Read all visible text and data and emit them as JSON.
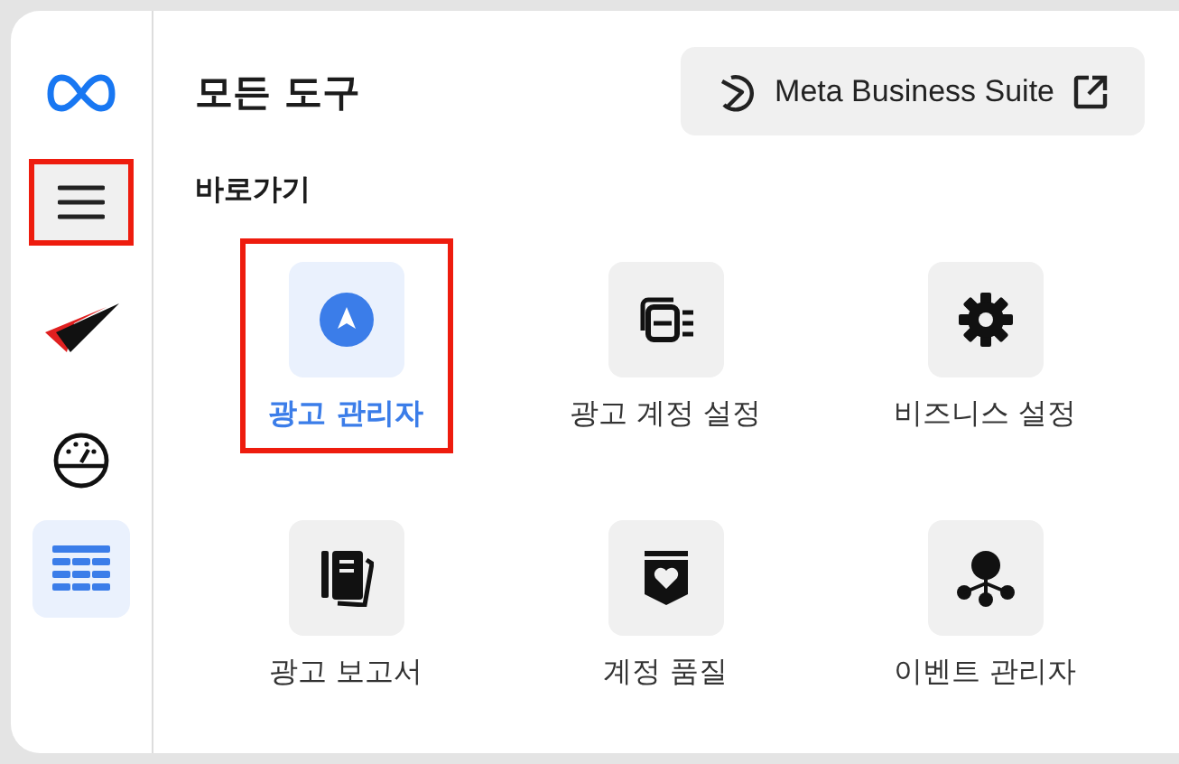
{
  "sidebar": {
    "items": [
      {
        "kind": "logo",
        "selected": false,
        "highlighted": false
      },
      {
        "kind": "menu",
        "selected": false,
        "highlighted": true
      },
      {
        "kind": "swoosh",
        "selected": false,
        "highlighted": false
      },
      {
        "kind": "gauge",
        "selected": false,
        "highlighted": false
      },
      {
        "kind": "table",
        "selected": true,
        "highlighted": false
      }
    ]
  },
  "header": {
    "title": "모든 도구",
    "button": "Meta Business Suite"
  },
  "section": {
    "title": "바로가기"
  },
  "tools": [
    {
      "kind": "compass",
      "label": "광고 관리자",
      "selected": true,
      "highlighted": true
    },
    {
      "kind": "cards",
      "label": "광고 계정 설정",
      "selected": false,
      "highlighted": false
    },
    {
      "kind": "gear",
      "label": "비즈니스 설정",
      "selected": false,
      "highlighted": false
    },
    {
      "kind": "book",
      "label": "광고 보고서",
      "selected": false,
      "highlighted": false
    },
    {
      "kind": "shield",
      "label": "계정 품질",
      "selected": false,
      "highlighted": false
    },
    {
      "kind": "nodes",
      "label": "이벤트 관리자",
      "selected": false,
      "highlighted": false
    }
  ]
}
